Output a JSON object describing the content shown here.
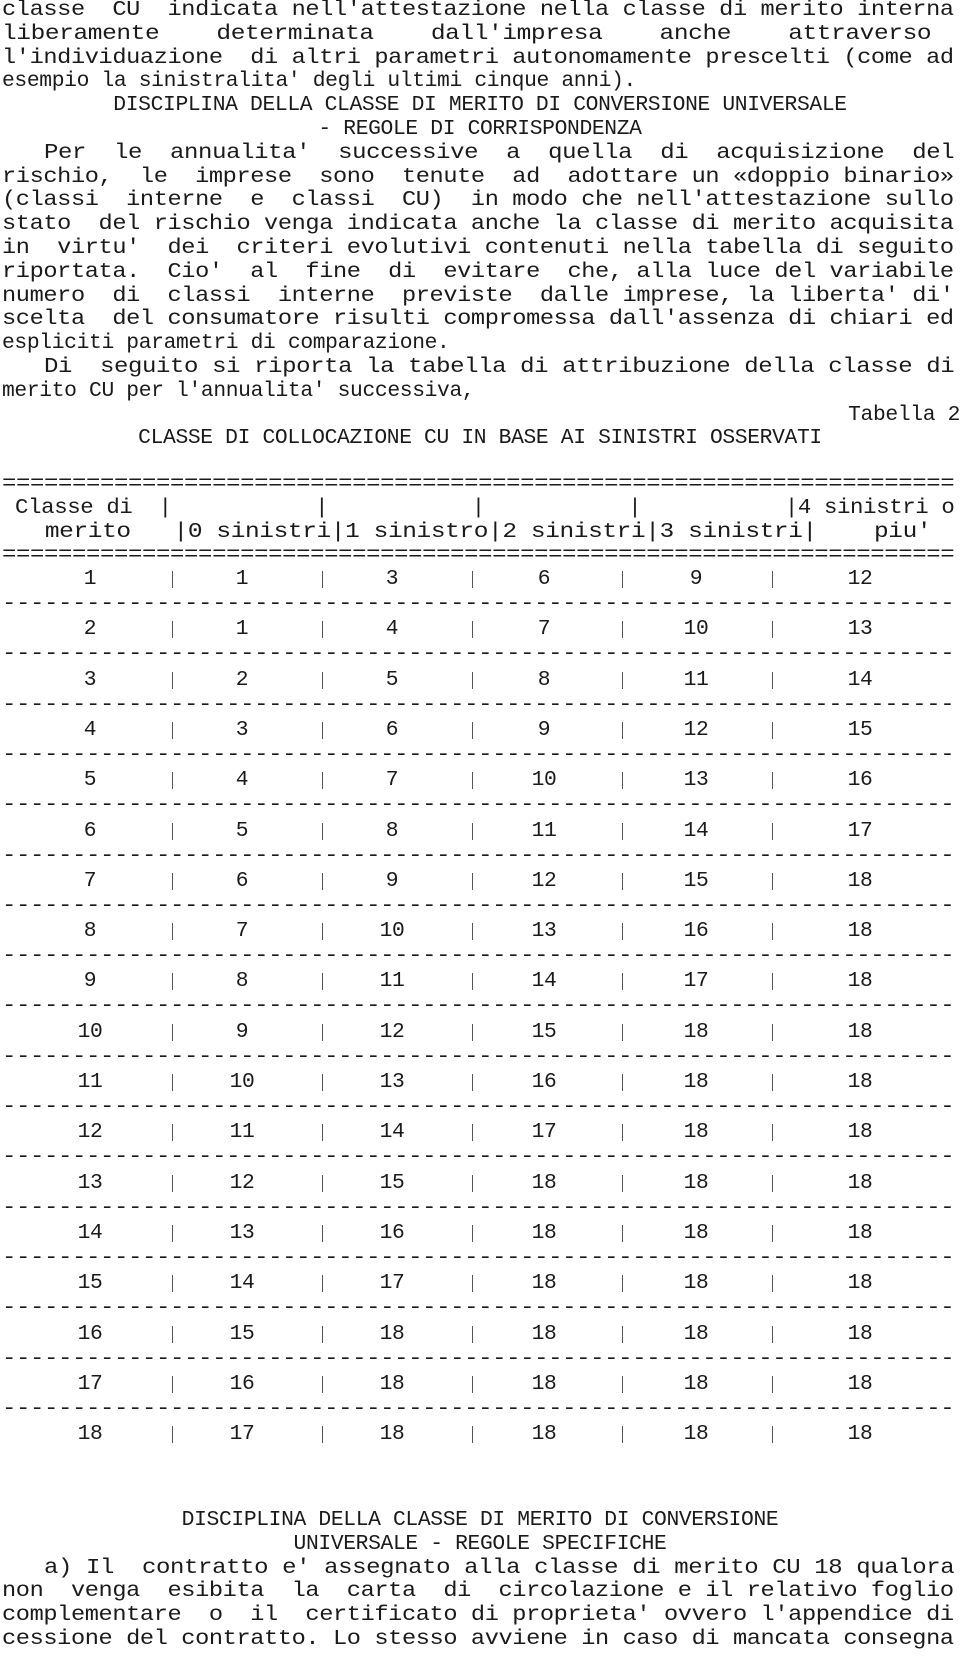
{
  "intro": [
    "classe  CU  indicata nell'attestazione nella classe di merito interna",
    "liberamente    determinata    dall'impresa    anche    attraverso",
    "l'individuazione  di altri parametri autonomamente prescelti (come ad",
    "esempio la sinistralita' degli ultimi cinque anni)."
  ],
  "heading1": [
    "DISCIPLINA DELLA CLASSE DI MERITO DI CONVERSIONE UNIVERSALE",
    "- REGOLE DI CORRISPONDENZA"
  ],
  "body1": [
    "   Per  le  annualita'  successive  a  quella  di  acquisizione  del",
    "rischio,  le  imprese  sono  tenute  ad  adottare un «doppio binario»",
    "(classi  interne  e  classi  CU)  in modo che nell'attestazione sullo",
    "stato  del rischio venga indicata anche la classe di merito acquisita",
    "in  virtu'  dei  criteri evolutivi contenuti nella tabella di seguito",
    "riportata.  Cio'  al  fine  di  evitare  che, alla luce del variabile",
    "numero  di  classi  interne  previste  dalle imprese, la liberta' di'",
    "scelta  del consumatore risulti compromessa dall'assenza di chiari ed",
    "espliciti parametri di comparazione.",
    "   Di  seguito si riporta la tabella di attribuzione della classe di",
    "merito CU per l'annualita' successiva,"
  ],
  "table_label": "Tabella 2",
  "table_title": "CLASSE DI COLLOCAZIONE CU IN BASE AI SINISTRI OSSERVATI",
  "table": {
    "rule_double": "====================================================================",
    "rule_single": "--------------------------------------------------------------------",
    "header_lines": [
      " Classe di  |           |           |           |           |4 sinistri o",
      "   merito   |0 sinistri|1 sinistro|2 sinistri|3 sinistri|    piu'"
    ],
    "columns": [
      "Classe di merito",
      "0 sinistri",
      "1 sinistro",
      "2 sinistri",
      "3 sinistri",
      "4 sinistri o piu'"
    ],
    "rows": [
      [
        "1",
        "1",
        "3",
        "6",
        "9",
        "12"
      ],
      [
        "2",
        "1",
        "4",
        "7",
        "10",
        "13"
      ],
      [
        "3",
        "2",
        "5",
        "8",
        "11",
        "14"
      ],
      [
        "4",
        "3",
        "6",
        "9",
        "12",
        "15"
      ],
      [
        "5",
        "4",
        "7",
        "10",
        "13",
        "16"
      ],
      [
        "6",
        "5",
        "8",
        "11",
        "14",
        "17"
      ],
      [
        "7",
        "6",
        "9",
        "12",
        "15",
        "18"
      ],
      [
        "8",
        "7",
        "10",
        "13",
        "16",
        "18"
      ],
      [
        "9",
        "8",
        "11",
        "14",
        "17",
        "18"
      ],
      [
        "10",
        "9",
        "12",
        "15",
        "18",
        "18"
      ],
      [
        "11",
        "10",
        "13",
        "16",
        "18",
        "18"
      ],
      [
        "12",
        "11",
        "14",
        "17",
        "18",
        "18"
      ],
      [
        "13",
        "12",
        "15",
        "18",
        "18",
        "18"
      ],
      [
        "14",
        "13",
        "16",
        "18",
        "18",
        "18"
      ],
      [
        "15",
        "14",
        "17",
        "18",
        "18",
        "18"
      ],
      [
        "16",
        "15",
        "18",
        "18",
        "18",
        "18"
      ],
      [
        "17",
        "16",
        "18",
        "18",
        "18",
        "18"
      ],
      [
        "18",
        "17",
        "18",
        "18",
        "18",
        "18"
      ]
    ]
  },
  "heading2": [
    "DISCIPLINA DELLA CLASSE DI MERITO DI CONVERSIONE",
    "UNIVERSALE - REGOLE SPECIFICHE"
  ],
  "body2": [
    "   a) Il  contratto e' assegnato alla classe di merito CU 18 qualora",
    "non  venga  esibita  la  carta  di  circolazione e il relativo foglio",
    "complementare  o  il  certificato di proprieta' ovvero l'appendice di",
    "cessione del contratto. Lo stesso avviene in caso di mancata consegna"
  ]
}
